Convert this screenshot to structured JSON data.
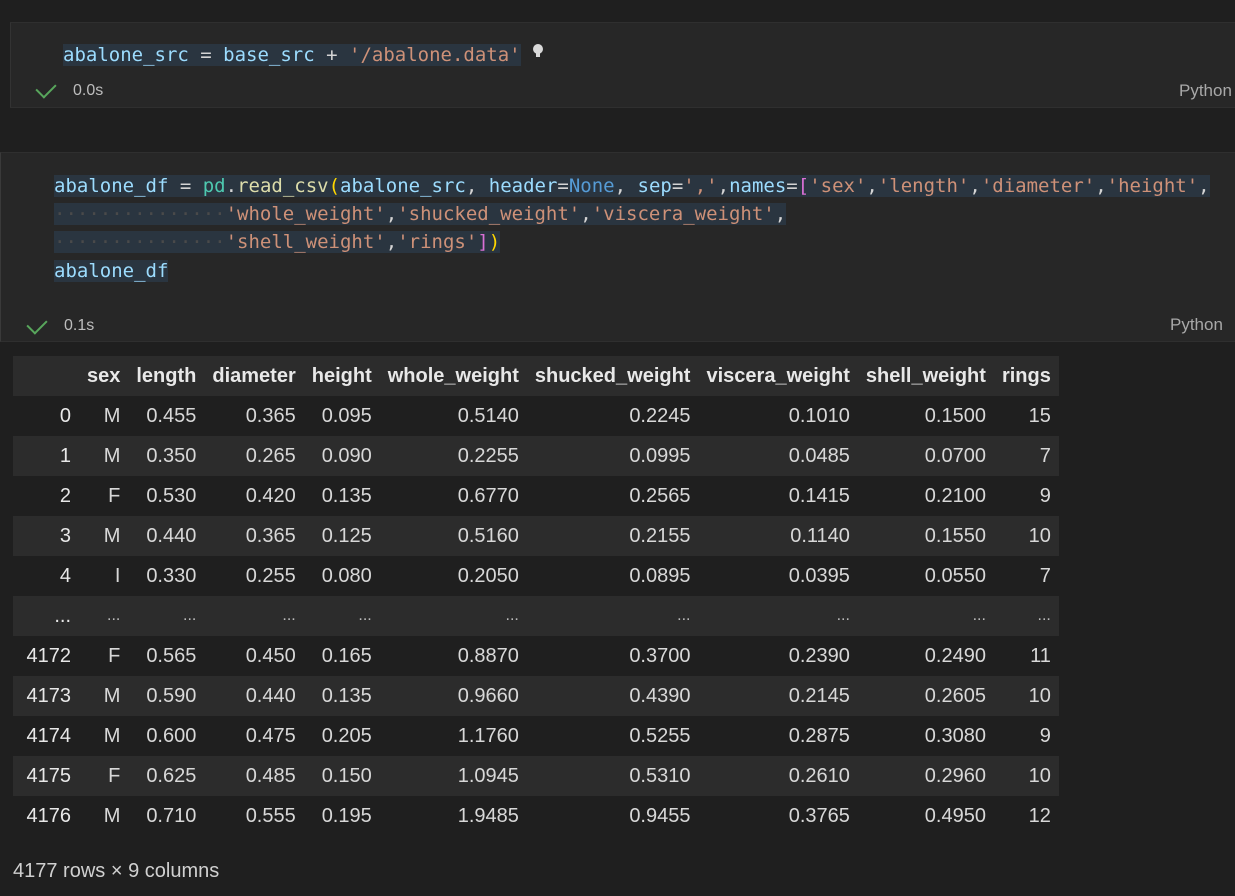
{
  "cells": [
    {
      "code": {
        "line1": {
          "var": "abalone_src",
          "eq": " = ",
          "var2": "base_src",
          "plus": " + ",
          "str": "'/abalone.data'"
        }
      },
      "status": {
        "time": "0.0s",
        "language": "Python"
      }
    },
    {
      "code": {
        "l1": {
          "var": "abalone_df",
          "eq": " = ",
          "mod": "pd",
          "dot": ".",
          "fn": "read_csv",
          "paren": "(",
          "arg1": "abalone_src",
          "comma": ", ",
          "kw1": "header",
          "eq2": "=",
          "none": "None",
          "comma2": ", ",
          "kw2": "sep",
          "eq3": "=",
          "sep_str": "','",
          "comma3": ",",
          "kw3": "names",
          "eq4": "=",
          "brk": "[",
          "s1": "'sex'",
          "s2": "'length'",
          "s3": "'diameter'",
          "s4": "'height'",
          "c": ",",
          "tail": ","
        },
        "l2": {
          "s5": "'whole_weight'",
          "s6": "'shucked_weight'",
          "s7": "'viscera_weight'",
          "c": ","
        },
        "l3": {
          "s8": "'shell_weight'",
          "s9": "'rings'",
          "c": ",",
          "close_brk": "]",
          "close_paren": ")"
        },
        "l4": {
          "var": "abalone_df"
        }
      },
      "status": {
        "time": "0.1s",
        "language": "Python"
      }
    }
  ],
  "table": {
    "columns": [
      "",
      "sex",
      "length",
      "diameter",
      "height",
      "whole_weight",
      "shucked_weight",
      "viscera_weight",
      "shell_weight",
      "rings"
    ],
    "rows": [
      [
        "0",
        "M",
        "0.455",
        "0.365",
        "0.095",
        "0.5140",
        "0.2245",
        "0.1010",
        "0.1500",
        "15"
      ],
      [
        "1",
        "M",
        "0.350",
        "0.265",
        "0.090",
        "0.2255",
        "0.0995",
        "0.0485",
        "0.0700",
        "7"
      ],
      [
        "2",
        "F",
        "0.530",
        "0.420",
        "0.135",
        "0.6770",
        "0.2565",
        "0.1415",
        "0.2100",
        "9"
      ],
      [
        "3",
        "M",
        "0.440",
        "0.365",
        "0.125",
        "0.5160",
        "0.2155",
        "0.1140",
        "0.1550",
        "10"
      ],
      [
        "4",
        "I",
        "0.330",
        "0.255",
        "0.080",
        "0.2050",
        "0.0895",
        "0.0395",
        "0.0550",
        "7"
      ],
      [
        "...",
        "...",
        "...",
        "...",
        "...",
        "...",
        "...",
        "...",
        "...",
        "..."
      ],
      [
        "4172",
        "F",
        "0.565",
        "0.450",
        "0.165",
        "0.8870",
        "0.3700",
        "0.2390",
        "0.2490",
        "11"
      ],
      [
        "4173",
        "M",
        "0.590",
        "0.440",
        "0.135",
        "0.9660",
        "0.4390",
        "0.2145",
        "0.2605",
        "10"
      ],
      [
        "4174",
        "M",
        "0.600",
        "0.475",
        "0.205",
        "1.1760",
        "0.5255",
        "0.2875",
        "0.3080",
        "9"
      ],
      [
        "4175",
        "F",
        "0.625",
        "0.485",
        "0.150",
        "1.0945",
        "0.5310",
        "0.2610",
        "0.2960",
        "10"
      ],
      [
        "4176",
        "M",
        "0.710",
        "0.555",
        "0.195",
        "1.9485",
        "0.9455",
        "0.3765",
        "0.4950",
        "12"
      ]
    ],
    "summary": "4177 rows × 9 columns"
  },
  "icons": {
    "run_status": "check-icon",
    "hint": "lightbulb-icon"
  },
  "colors": {
    "success": "#58a65c",
    "string": "#ce9178",
    "variable": "#9cdcfe",
    "function": "#dcdcaa",
    "keyword": "#569cd6"
  }
}
